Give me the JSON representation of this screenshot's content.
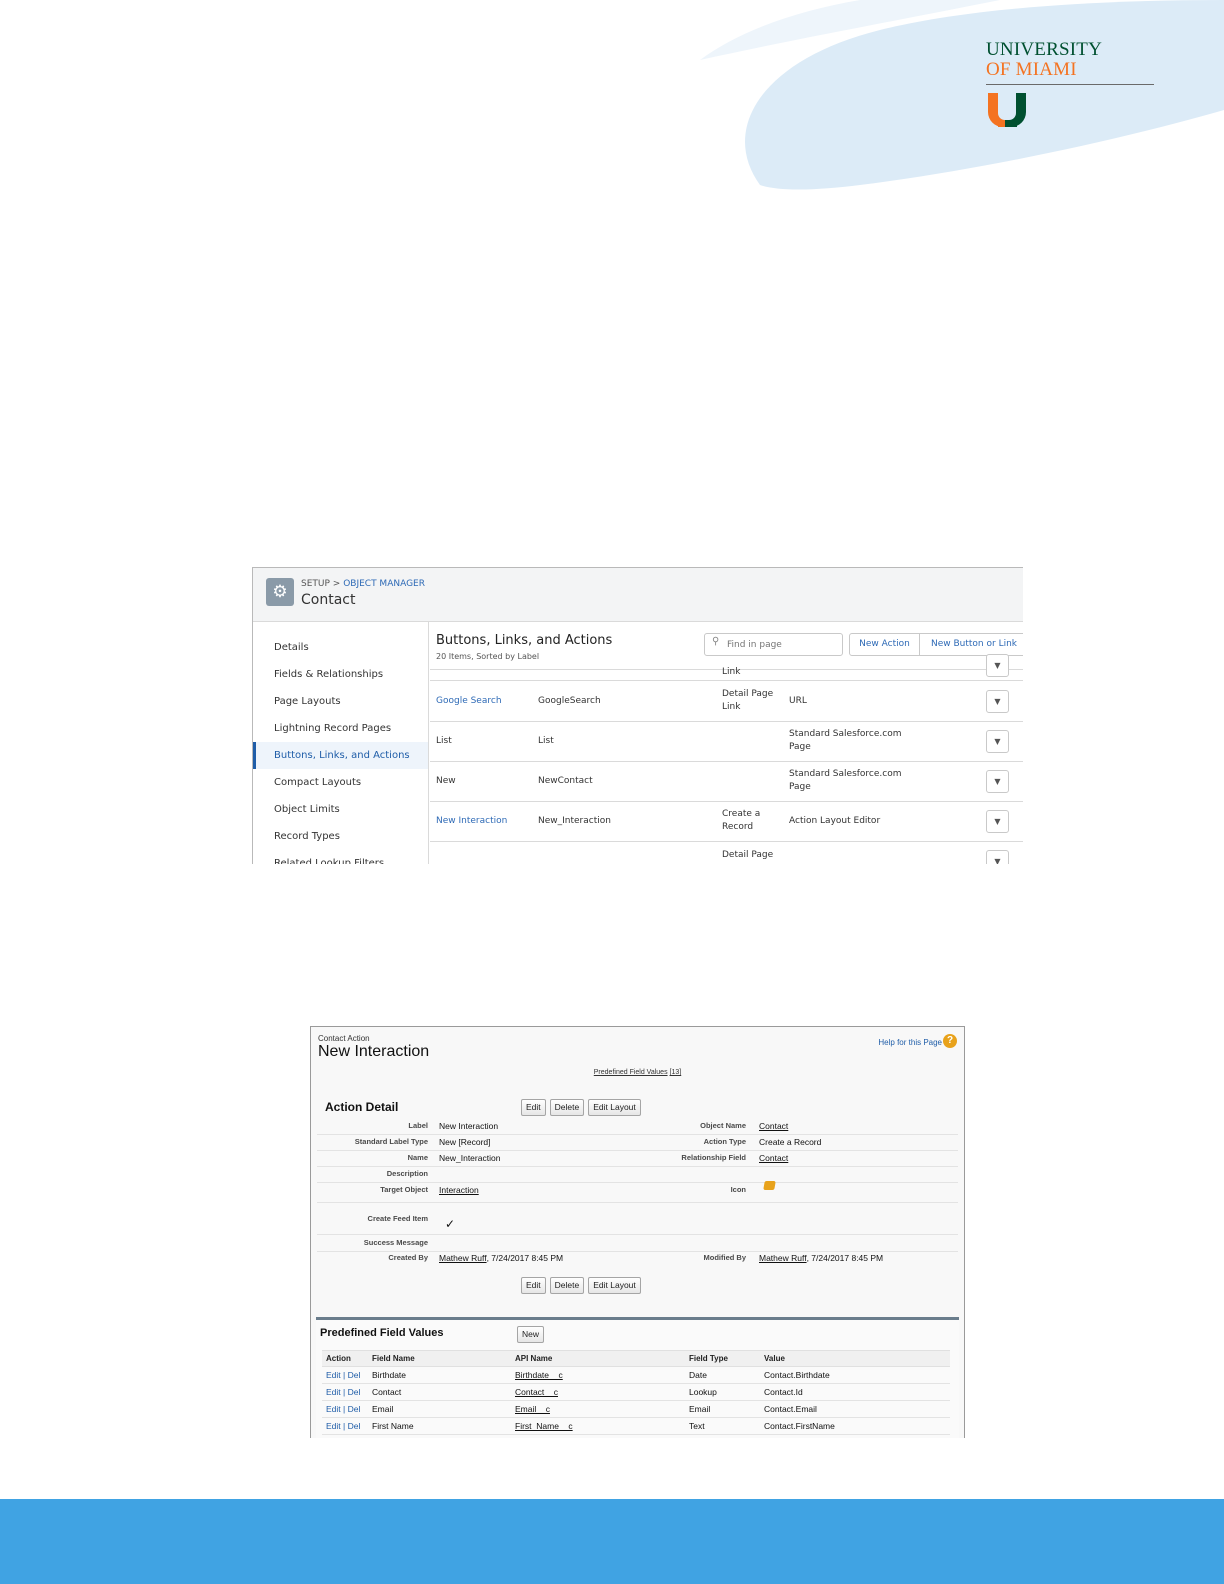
{
  "logo": {
    "line1": "UNIVERSITY",
    "line2": "OF MIAMI",
    "brand_green": "#005030",
    "brand_orange": "#f47321"
  },
  "footer_color": "#40a3e3",
  "lightning": {
    "breadcrumb_setup": "SETUP > ",
    "breadcrumb_link": "OBJECT MANAGER",
    "object_title": "Contact",
    "sidebar": [
      {
        "label": "Details",
        "active": false
      },
      {
        "label": "Fields & Relationships",
        "active": false
      },
      {
        "label": "Page Layouts",
        "active": false
      },
      {
        "label": "Lightning Record Pages",
        "active": false
      },
      {
        "label": "Buttons, Links, and Actions",
        "active": true
      },
      {
        "label": "Compact Layouts",
        "active": false
      },
      {
        "label": "Object Limits",
        "active": false
      },
      {
        "label": "Record Types",
        "active": false
      },
      {
        "label": "Related Lookup Filters",
        "active": false
      }
    ],
    "main_title": "Buttons, Links, and Actions",
    "main_subtitle": "20 Items, Sorted by Label",
    "search_placeholder": "Find in page",
    "new_action_label": "New Action",
    "new_button_label": "New Button or Link",
    "partial_top_type": "Link",
    "partial_bottom_type": "Detail Page",
    "rows": [
      {
        "label": "Google Search",
        "name": "GoogleSearch",
        "display_type": "Detail Page Link",
        "content": "URL",
        "link": true
      },
      {
        "label": "List",
        "name": "List",
        "display_type": "",
        "content": "Standard Salesforce.com Page",
        "link": false
      },
      {
        "label": "New",
        "name": "NewContact",
        "display_type": "",
        "content": "Standard Salesforce.com Page",
        "link": false
      },
      {
        "label": "New Interaction",
        "name": "New_Interaction",
        "display_type": "Create a Record",
        "content": "Action Layout Editor",
        "link": true
      }
    ]
  },
  "classic": {
    "kicker": "Contact Action",
    "title": "New Interaction",
    "help_label": "Help for this Page",
    "predefined_link": "Predefined Field Values",
    "predefined_count": "[13]",
    "section_title": "Action Detail",
    "buttons": {
      "edit": "Edit",
      "delete": "Delete",
      "edit_layout": "Edit Layout"
    },
    "details_left": [
      {
        "label": "Label",
        "value": "New Interaction"
      },
      {
        "label": "Standard Label Type",
        "value": "New [Record]"
      },
      {
        "label": "Name",
        "value": "New_Interaction"
      },
      {
        "label": "Description",
        "value": ""
      },
      {
        "label": "Target Object",
        "value": "Interaction"
      }
    ],
    "details_right": [
      {
        "label": "Object Name",
        "value": "Contact"
      },
      {
        "label": "Action Type",
        "value": "Create a Record"
      },
      {
        "label": "Relationship Field",
        "value": "Contact"
      },
      {
        "label": "",
        "value": ""
      },
      {
        "label": "Icon",
        "value": ""
      }
    ],
    "create_feed_item_label": "Create Feed Item",
    "create_feed_item_value": "✓",
    "success_message_label": "Success Message",
    "created_by_label": "Created By",
    "created_by_user": "Mathew Ruff",
    "created_by_date": ", 7/24/2017 8:45 PM",
    "modified_by_label": "Modified By",
    "modified_by_user": "Mathew Ruff",
    "modified_by_date": ", 7/24/2017 8:45 PM",
    "pfv_title": "Predefined Field Values",
    "pfv_new": "New",
    "pfv_columns": [
      "Action",
      "Field Name",
      "API Name",
      "Field Type",
      "Value"
    ],
    "pfv_rows": [
      {
        "edit": "Edit",
        "del": "Del",
        "field": "Birthdate",
        "api": "Birthdate__c",
        "type": "Date",
        "value": "Contact.Birthdate"
      },
      {
        "edit": "Edit",
        "del": "Del",
        "field": "Contact",
        "api": "Contact__c",
        "type": "Lookup",
        "value": "Contact.Id"
      },
      {
        "edit": "Edit",
        "del": "Del",
        "field": "Email",
        "api": "Email__c",
        "type": "Email",
        "value": "Contact.Email"
      },
      {
        "edit": "Edit",
        "del": "Del",
        "field": "First Name",
        "api": "First_Name__c",
        "type": "Text",
        "value": "Contact.FirstName"
      }
    ]
  }
}
